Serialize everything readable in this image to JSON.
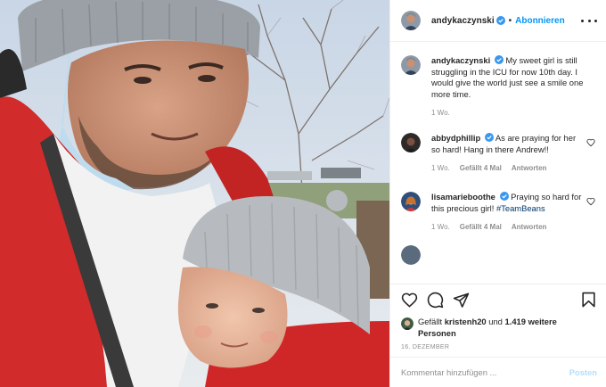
{
  "post": {
    "author": "andykaczynski",
    "follow_label": "Abonnieren",
    "separator": "•",
    "colors": {
      "verified": "#3897f0",
      "link": "#0095f6",
      "hashtag": "#00376b",
      "muted": "#8e8e8e"
    }
  },
  "caption": {
    "user": "andykaczynski",
    "text": "My sweet girl is still struggling in the ICU for now 10th day. I would give the world just see a smile one more time.",
    "age": "1 Wo."
  },
  "comments": [
    {
      "user": "abbydphillip",
      "text": "As are praying for her so hard! Hang in there Andrew!!",
      "age": "1 Wo.",
      "likes": "Gefällt 4 Mal",
      "reply": "Antworten"
    },
    {
      "user": "lisamarieboothe",
      "text": "Praying so hard for this precious girl!",
      "hashtag": "#TeamBeans",
      "age": "1 Wo.",
      "likes": "Gefällt 4 Mal",
      "reply": "Antworten"
    }
  ],
  "actions": {
    "icons": [
      "heart-icon",
      "comment-icon",
      "share-icon",
      "bookmark-icon"
    ]
  },
  "likes": {
    "prefix": "Gefällt",
    "user": "kristenh20",
    "conj": "und",
    "others": "1.419 weitere Personen"
  },
  "date": "16. DEZEMBER",
  "composer": {
    "placeholder": "Kommentar hinzufügen ...",
    "post_label": "Posten"
  }
}
